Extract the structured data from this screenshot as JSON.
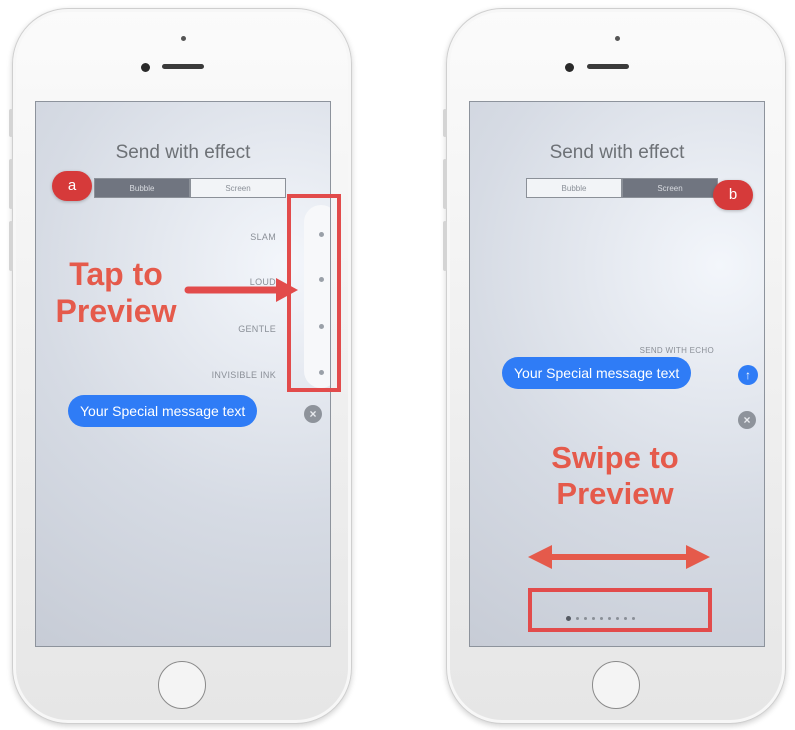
{
  "left_panel": {
    "screen_title": "Send with effect",
    "tabs": [
      {
        "label": "Bubble",
        "active": true
      },
      {
        "label": "Screen",
        "active": false
      }
    ],
    "badge": "a",
    "effects": [
      {
        "label": "SLAM"
      },
      {
        "label": "LOUD"
      },
      {
        "label": "GENTLE"
      },
      {
        "label": "INVISIBLE INK"
      }
    ],
    "message_text": "Your Special message text",
    "annotation": {
      "line1": "Tap to",
      "line2": "Preview"
    },
    "cancel_icon": "close-icon"
  },
  "right_panel": {
    "screen_title": "Send with effect",
    "tabs": [
      {
        "label": "Bubble",
        "active": false
      },
      {
        "label": "Screen",
        "active": true
      }
    ],
    "badge": "b",
    "effect_name": "SEND WITH ECHO",
    "message_text": "Your Special message text",
    "annotation": {
      "line1": "Swipe to",
      "line2": "Preview"
    },
    "send_icon": "arrow-up-icon",
    "cancel_icon": "close-icon",
    "page_indicator": {
      "count": 9,
      "current": 1
    }
  },
  "colors": {
    "accent_red": "#e24b4b",
    "annotation_red": "#e55a4b",
    "imessage_blue": "#2f7cf6",
    "badge_red": "#d63a3a"
  }
}
